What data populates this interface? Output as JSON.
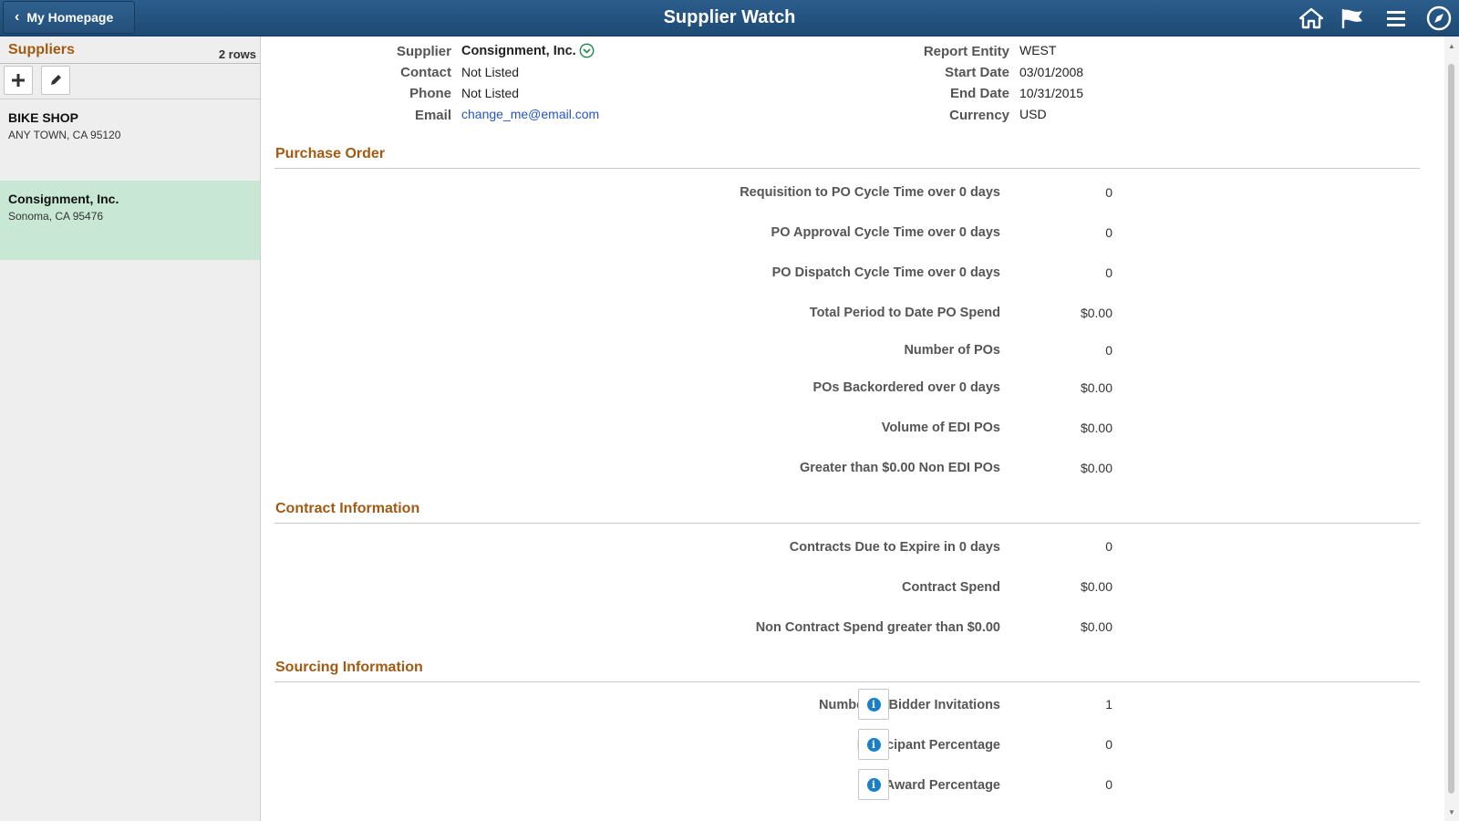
{
  "header": {
    "back_label": "My Homepage",
    "title": "Supplier Watch",
    "icons": [
      "home-icon",
      "flag-icon",
      "menu-icon",
      "navbar-compass-icon"
    ],
    "bar_color": "#245482"
  },
  "sidebar": {
    "heading": "Suppliers",
    "row_count": "2 rows",
    "tools": [
      "add-icon",
      "edit-icon"
    ],
    "suppliers": [
      {
        "name": "BIKE SHOP",
        "address": "ANY TOWN, CA  95120",
        "selected": false
      },
      {
        "name": "Consignment, Inc.",
        "address": "Sonoma, CA  95476",
        "selected": true
      }
    ]
  },
  "details": {
    "supplier_label": "Supplier",
    "supplier_value": "Consignment, Inc.",
    "contact_label": "Contact",
    "contact_value": "Not Listed",
    "phone_label": "Phone",
    "phone_value": "Not Listed",
    "email_label": "Email",
    "email_value": "change_me@email.com",
    "report_entity_label": "Report Entity",
    "report_entity_value": "WEST",
    "start_date_label": "Start Date",
    "start_date_value": "03/01/2008",
    "end_date_label": "End Date",
    "end_date_value": "10/31/2015",
    "currency_label": "Currency",
    "currency_value": "USD"
  },
  "sections": {
    "purchase_order": {
      "title": "Purchase Order",
      "metrics": [
        {
          "label": "Requisition to PO Cycle Time over 0 days",
          "value": "0"
        },
        {
          "label": "PO Approval Cycle Time over 0 days",
          "value": "0"
        },
        {
          "label": "PO Dispatch Cycle Time over 0 days",
          "value": "0"
        },
        {
          "label": "Total Period to Date PO Spend",
          "value": "$0.00"
        },
        {
          "label": "Number of POs",
          "value": "0"
        },
        {
          "label": "POs Backordered over 0 days",
          "value": "$0.00"
        },
        {
          "label": "Volume of EDI POs",
          "value": "$0.00"
        },
        {
          "label": "Greater than $0.00 Non EDI POs",
          "value": "$0.00"
        }
      ]
    },
    "contract": {
      "title": "Contract Information",
      "metrics": [
        {
          "label": "Contracts Due to Expire in 0 days",
          "value": "0"
        },
        {
          "label": "Contract Spend",
          "value": "$0.00"
        },
        {
          "label": "Non Contract Spend greater than $0.00",
          "value": "$0.00"
        }
      ]
    },
    "sourcing": {
      "title": "Sourcing Information",
      "metrics": [
        {
          "label": "Number of Bidder Invitations",
          "value": "1",
          "info_icon": "info-icon"
        },
        {
          "label": "Participant Percentage",
          "value": "0",
          "info_icon": "info-icon"
        },
        {
          "label": "Award Percentage",
          "value": "0",
          "info_icon": "info-icon"
        }
      ]
    }
  },
  "colors": {
    "section_title": "#a25a12",
    "selected_row": "#c8e8d5",
    "link": "#2556c4"
  }
}
